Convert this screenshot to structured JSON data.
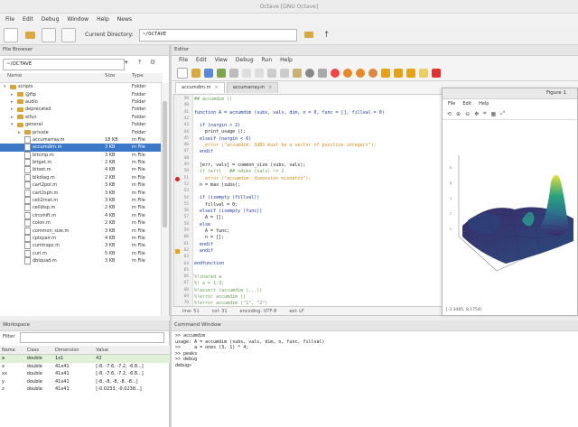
{
  "window_title": "Octave [GNU Octave]",
  "menubar": [
    "File",
    "Edit",
    "Debug",
    "Window",
    "Help",
    "News"
  ],
  "toolbar": {
    "cwd_label": "Current Directory:",
    "cwd_value": "~/OCTAVE"
  },
  "file_browser": {
    "title": "File Browser",
    "path": "~/OCTAVE",
    "columns": [
      "Name",
      "Size",
      "Type"
    ],
    "rows": [
      {
        "name": "scripts",
        "size": "",
        "type": "Folder",
        "kind": "folder",
        "indent": 0,
        "expanded": true
      },
      {
        "name": "@ftp",
        "size": "",
        "type": "Folder",
        "kind": "folder",
        "indent": 1
      },
      {
        "name": "audio",
        "size": "",
        "type": "Folder",
        "kind": "folder",
        "indent": 1
      },
      {
        "name": "deprecated",
        "size": "",
        "type": "Folder",
        "kind": "folder",
        "indent": 1
      },
      {
        "name": "elfun",
        "size": "",
        "type": "Folder",
        "kind": "folder",
        "indent": 1
      },
      {
        "name": "general",
        "size": "",
        "type": "Folder",
        "kind": "folder",
        "indent": 1,
        "expanded": true
      },
      {
        "name": "private",
        "size": "",
        "type": "Folder",
        "kind": "folder",
        "indent": 2
      },
      {
        "name": "accumarray.m",
        "size": "18 KB",
        "type": "m File",
        "kind": "file",
        "indent": 2
      },
      {
        "name": "accumdim.m",
        "size": "3 KB",
        "type": "m File",
        "kind": "file",
        "indent": 2,
        "selected": true
      },
      {
        "name": "bitcmp.m",
        "size": "3 KB",
        "type": "m File",
        "kind": "file",
        "indent": 2
      },
      {
        "name": "bitget.m",
        "size": "2 KB",
        "type": "m File",
        "kind": "file",
        "indent": 2
      },
      {
        "name": "bitset.m",
        "size": "4 KB",
        "type": "m File",
        "kind": "file",
        "indent": 2
      },
      {
        "name": "blkdiag.m",
        "size": "2 KB",
        "type": "m File",
        "kind": "file",
        "indent": 2
      },
      {
        "name": "cart2pol.m",
        "size": "3 KB",
        "type": "m File",
        "kind": "file",
        "indent": 2
      },
      {
        "name": "cart2sph.m",
        "size": "3 KB",
        "type": "m File",
        "kind": "file",
        "indent": 2
      },
      {
        "name": "cell2mat.m",
        "size": "3 KB",
        "type": "m File",
        "kind": "file",
        "indent": 2
      },
      {
        "name": "celldisp.m",
        "size": "2 KB",
        "type": "m File",
        "kind": "file",
        "indent": 2
      },
      {
        "name": "circshift.m",
        "size": "4 KB",
        "type": "m File",
        "kind": "file",
        "indent": 2
      },
      {
        "name": "colon.m",
        "size": "2 KB",
        "type": "m File",
        "kind": "file",
        "indent": 2
      },
      {
        "name": "common_size.m",
        "size": "3 KB",
        "type": "m File",
        "kind": "file",
        "indent": 2
      },
      {
        "name": "cplxpair.m",
        "size": "4 KB",
        "type": "m File",
        "kind": "file",
        "indent": 2
      },
      {
        "name": "cumtrapz.m",
        "size": "3 KB",
        "type": "m File",
        "kind": "file",
        "indent": 2
      },
      {
        "name": "curl.m",
        "size": "5 KB",
        "type": "m File",
        "kind": "file",
        "indent": 2
      },
      {
        "name": "dblquad.m",
        "size": "3 KB",
        "type": "m File",
        "kind": "file",
        "indent": 2
      }
    ]
  },
  "workspace": {
    "title": "Workspace",
    "filter_label": "Filter",
    "columns": [
      "Name",
      "Class",
      "Dimension",
      "Value"
    ],
    "rows": [
      {
        "name": "a",
        "class": "double",
        "dim": "1x1",
        "value": "42",
        "highlight": true
      },
      {
        "name": "x",
        "class": "double",
        "dim": "41x41",
        "value": "[-8, -7.6, -7.2, -6.8...]"
      },
      {
        "name": "xx",
        "class": "double",
        "dim": "41x41",
        "value": "[-8, -7.6, -7.2, -6.8...]"
      },
      {
        "name": "y",
        "class": "double",
        "dim": "41x41",
        "value": "[-8, -8, -8, -8, -8...]"
      },
      {
        "name": "z",
        "class": "double",
        "dim": "41x41",
        "value": "[-0.0233, -0.0238...]"
      }
    ]
  },
  "editor": {
    "title": "Editor",
    "menu": [
      "File",
      "Edit",
      "View",
      "Debug",
      "Run",
      "Help"
    ],
    "tabs": [
      {
        "label": "accumdim.m",
        "active": true
      },
      {
        "label": "accumarray.m",
        "active": false
      }
    ],
    "lines": [
      {
        "n": "39",
        "t": "## accumdim ()",
        "c": "#6a9b58"
      },
      {
        "n": "40",
        "t": "",
        "c": "#222"
      },
      {
        "n": "41",
        "t": "function A = accumdim (subs, vals, dim, n = 0, func = [], fillval = 0)",
        "c": "#1c35a8"
      },
      {
        "n": "42",
        "t": "",
        "c": "#222"
      },
      {
        "n": "43",
        "t": "  if (nargin < 2)",
        "c": "#1c35a8"
      },
      {
        "n": "44",
        "t": "    print_usage ();",
        "c": "#222"
      },
      {
        "n": "45",
        "t": "  elseif (nargin < 6)",
        "c": "#1c35a8"
      },
      {
        "n": "46",
        "t": "    error (\"accumdim: SUBS must be a vector of positive integers\");",
        "c": "#d88a1a"
      },
      {
        "n": "47",
        "t": "  endif",
        "c": "#1c35a8"
      },
      {
        "n": "48",
        "t": "",
        "c": "#222"
      },
      {
        "n": "49",
        "t": "  [err, vals] = common_size (subs, vals);",
        "c": "#222"
      },
      {
        "n": "50",
        "t": "  if (err)   ## ndims (vals) != 2",
        "c": "#6a9b58"
      },
      {
        "n": "51",
        "t": "    error (\"accumdim: dimension mismatch\");",
        "c": "#d88a1a"
      },
      {
        "n": "52",
        "t": "  n = max (subs);",
        "c": "#222"
      },
      {
        "n": "53",
        "t": "",
        "c": "#222"
      },
      {
        "n": "54",
        "t": "  if (isempty (fillval))",
        "c": "#1c35a8"
      },
      {
        "n": "55",
        "t": "    fillval = 0;",
        "c": "#222"
      },
      {
        "n": "56",
        "t": "  elseif (isempty (func))",
        "c": "#1c35a8"
      },
      {
        "n": "57",
        "t": "    A = [];",
        "c": "#222"
      },
      {
        "n": "58",
        "t": "  else",
        "c": "#1c35a8"
      },
      {
        "n": "59",
        "t": "    A = func;",
        "c": "#222"
      },
      {
        "n": "60",
        "t": "    n = [];",
        "c": "#222"
      },
      {
        "n": "61",
        "t": "  endif",
        "c": "#1c35a8"
      },
      {
        "n": "62",
        "t": "  endif",
        "c": "#1c35a8"
      },
      {
        "n": "63",
        "t": "",
        "c": "#222"
      },
      {
        "n": "64",
        "t": "endfunction",
        "c": "#1c35a8"
      },
      {
        "n": "65",
        "t": "",
        "c": "#222"
      },
      {
        "n": "66",
        "t": "%!shared a",
        "c": "#6a9b58"
      },
      {
        "n": "67",
        "t": "%! a = 1:3;",
        "c": "#6a9b58"
      },
      {
        "n": "68",
        "t": "%!assert (accumdim (...))",
        "c": "#6a9b58"
      },
      {
        "n": "69",
        "t": "%!error accumdim ()",
        "c": "#6a9b58"
      },
      {
        "n": "70",
        "t": "%!error accumdim (\"1\", \"2\")",
        "c": "#6a9b58"
      }
    ],
    "status": {
      "line": "line: 51",
      "col": "col: 31",
      "encoding": "encoding: UTF-8",
      "eol": "eol: LF"
    }
  },
  "figure": {
    "title": "Figure 1",
    "menu": [
      "File",
      "Edit",
      "Help"
    ],
    "status": "[-3.3485, 8.1754]"
  },
  "command_window": {
    "title": "Command Window",
    "lines": [
      ">> accumdim",
      "usage: A = accumdim (subs, vals, dim, n, func, fillval)",
      ">>     a = ones (3, 1) * 4;",
      ">> peaks",
      ">> debug",
      "debug>"
    ]
  }
}
